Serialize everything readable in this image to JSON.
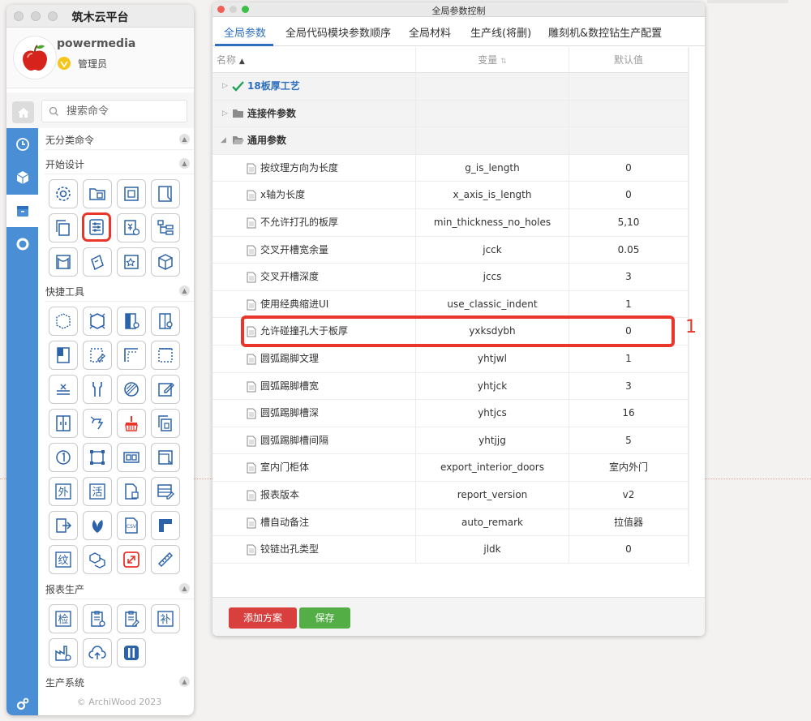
{
  "app": {
    "window_title": "筑木云平台",
    "user": {
      "name": "powermedia",
      "role": "管理员"
    },
    "search": {
      "placeholder": "搜索命令"
    },
    "sections": {
      "uncategorized": "无分类命令",
      "start_design": "开始设计",
      "quick_tools": "快捷工具",
      "report_production": "报表生产",
      "production_system": "生产系统"
    },
    "quick_tool_labels": [
      "外",
      "活",
      "纹"
    ],
    "report_tool_labels": [
      "检",
      "补"
    ],
    "copyright": "© ArchiWood 2023"
  },
  "dialog": {
    "title": "全局参数控制",
    "tabs": [
      "全局参数",
      "全局代码模块参数顺序",
      "全局材料",
      "生产线(将删)",
      "雕刻机&数控钻生产配置"
    ],
    "active_tab": 0,
    "columns": {
      "name": "名称",
      "variable": "变量",
      "default": "默认值"
    },
    "groups": [
      "18板厚工艺",
      "连接件参数",
      "通用参数"
    ],
    "rows": [
      {
        "name": "按纹理方向为长度",
        "var": "g_is_length",
        "val": "0"
      },
      {
        "name": "x轴为长度",
        "var": "x_axis_is_length",
        "val": "0"
      },
      {
        "name": "不允许打孔的板厚",
        "var": "min_thickness_no_holes",
        "val": "5,10"
      },
      {
        "name": "交叉开槽宽余量",
        "var": "jcck",
        "val": "0.05"
      },
      {
        "name": "交叉开槽深度",
        "var": "jccs",
        "val": "3"
      },
      {
        "name": "使用经典缩进UI",
        "var": "use_classic_indent",
        "val": "1"
      },
      {
        "name": "允许碰撞孔大于板厚",
        "var": "yxksdybh",
        "val": "0"
      },
      {
        "name": "圆弧踢脚文理",
        "var": "yhtjwl",
        "val": "1"
      },
      {
        "name": "圆弧踢脚槽宽",
        "var": "yhtjck",
        "val": "3"
      },
      {
        "name": "圆弧踢脚槽深",
        "var": "yhtjcs",
        "val": "16"
      },
      {
        "name": "圆弧踢脚槽间隔",
        "var": "yhtjjg",
        "val": "5"
      },
      {
        "name": "室内门柜体",
        "var": "export_interior_doors",
        "val": "室内外门"
      },
      {
        "name": "报表版本",
        "var": "report_version",
        "val": "v2"
      },
      {
        "name": "槽自动备注",
        "var": "auto_remark",
        "val": "拉值器"
      },
      {
        "name": "铰链出孔类型",
        "var": "jldk",
        "val": "0"
      }
    ],
    "buttons": {
      "add_scheme": "添加方案",
      "save": "保存"
    }
  },
  "annotation": {
    "label": "1"
  },
  "colors": {
    "accent_blue": "#2e6fbe",
    "nav_blue": "#4a8fd6",
    "highlight_red": "#e9352a",
    "btn_red": "#d93f3c",
    "btn_green": "#54ae46",
    "check_green": "#1fa15a"
  }
}
